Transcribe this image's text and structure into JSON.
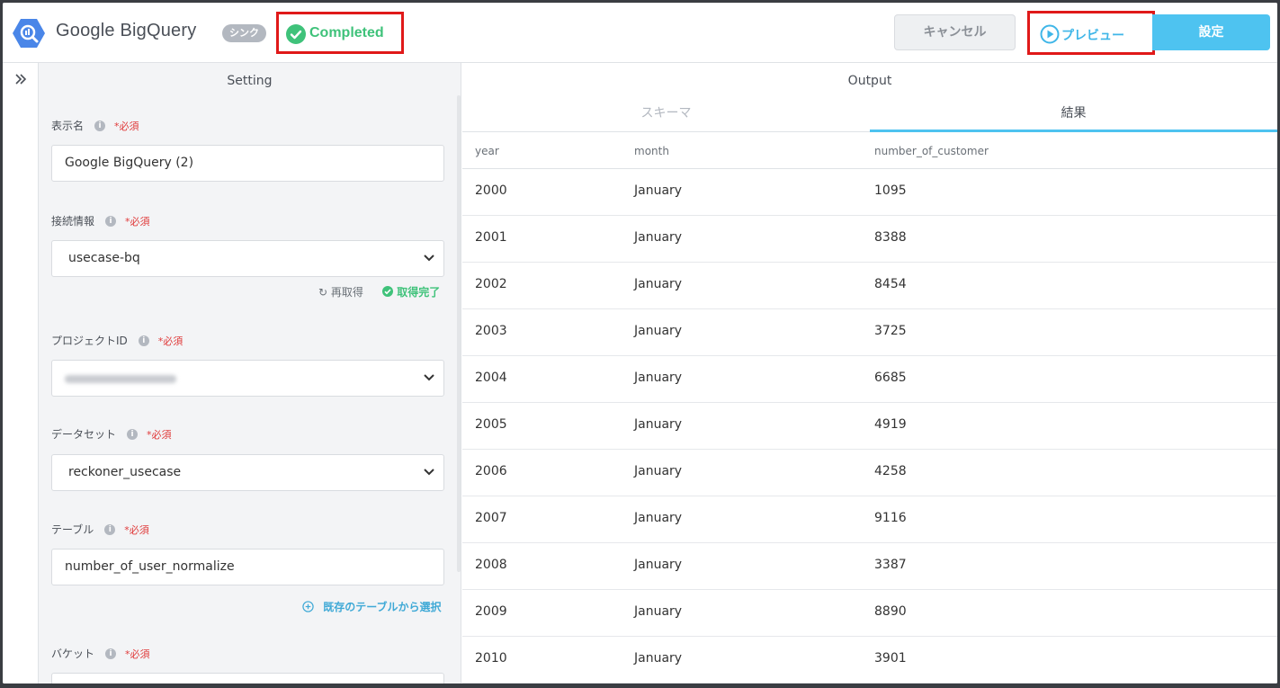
{
  "header": {
    "app_title": "Google BigQuery",
    "sync_badge": "シンク",
    "status": "Completed",
    "cancel_label": "キャンセル",
    "preview_label": "プレビュー",
    "settings_label": "設定",
    "logo_icon": "bigquery-logo-icon"
  },
  "colors": {
    "accent": "#4ec3f0",
    "success": "#3fc27a",
    "highlight_border": "#e01919",
    "required": "#e03a3a"
  },
  "setting": {
    "title": "Setting",
    "required_mark": "*必須",
    "display_name": {
      "label": "表示名",
      "value": "Google BigQuery (2)"
    },
    "connection": {
      "label": "接続情報",
      "value": "usecase-bq",
      "refetch_label": "再取得",
      "fetched_label": "取得完了"
    },
    "project_id": {
      "label": "プロジェクトID"
    },
    "dataset": {
      "label": "データセット",
      "value": "reckoner_usecase"
    },
    "table": {
      "label": "テーブル",
      "value": "number_of_user_normalize",
      "existing_label": "既存のテーブルから選択"
    },
    "bucket": {
      "label": "バケット"
    }
  },
  "output": {
    "title": "Output",
    "tabs": [
      "スキーマ",
      "結果"
    ],
    "columns": [
      "year",
      "month",
      "number_of_customer"
    ],
    "rows": [
      [
        "2000",
        "January",
        "1095"
      ],
      [
        "2001",
        "January",
        "8388"
      ],
      [
        "2002",
        "January",
        "8454"
      ],
      [
        "2003",
        "January",
        "3725"
      ],
      [
        "2004",
        "January",
        "6685"
      ],
      [
        "2005",
        "January",
        "4919"
      ],
      [
        "2006",
        "January",
        "4258"
      ],
      [
        "2007",
        "January",
        "9116"
      ],
      [
        "2008",
        "January",
        "3387"
      ],
      [
        "2009",
        "January",
        "8890"
      ],
      [
        "2010",
        "January",
        "3901"
      ]
    ]
  }
}
